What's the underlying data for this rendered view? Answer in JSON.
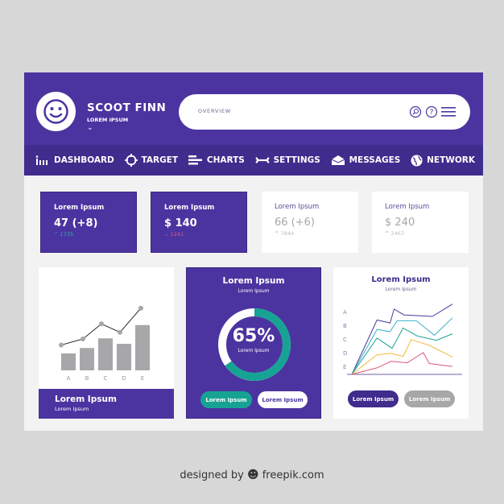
{
  "user": {
    "name": "SCOOT FINN",
    "subtitle": "LOREM IPSUM"
  },
  "search": {
    "label": "OVERVIEW",
    "icons": [
      "search-icon",
      "help-icon",
      "menu-icon"
    ]
  },
  "nav": [
    {
      "label": "DASHBOARD",
      "icon": "dashboard-icon"
    },
    {
      "label": "TARGET",
      "icon": "target-icon"
    },
    {
      "label": "CHARTS",
      "icon": "charts-icon"
    },
    {
      "label": "SETTINGS",
      "icon": "settings-icon"
    },
    {
      "label": "MESSAGES",
      "icon": "messages-icon"
    },
    {
      "label": "NETWORK",
      "icon": "network-icon"
    }
  ],
  "stats": [
    {
      "title": "Lorem Ipsum",
      "value": "47 (+8)",
      "sub": "1735",
      "trend": "up"
    },
    {
      "title": "Lorem Ipsum",
      "value": "$ 140",
      "sub": "1241",
      "trend": "down"
    },
    {
      "title": "Lorem Ipsum",
      "value": "66 (+6)",
      "sub": "7844",
      "trend": "up"
    },
    {
      "title": "Lorem Ipsum",
      "value": "$ 240",
      "sub": "2467",
      "trend": "up"
    }
  ],
  "card1": {
    "title": "Lorem Ipsum",
    "subtitle": "Lorem Ipsum"
  },
  "card2": {
    "title": "Lorem Ipsum",
    "subtitle": "Lorem Ipsum",
    "percent_label": "65%",
    "center_sub": "Lorem Ipsum",
    "btn1": "Lorem Ipsum",
    "btn2": "Lorem Ipsum"
  },
  "card3": {
    "title": "Lorem Ipsum",
    "subtitle": "Lorem Ipsum",
    "btn1": "Lorem Ipsum",
    "btn2": "Lorem Ipsum"
  },
  "colors": {
    "primary": "#4b34a0",
    "nav": "#3f2c8c",
    "teal": "#17a394",
    "up": "#2bb3a3",
    "down": "#e0577a"
  },
  "chart_data": [
    {
      "type": "bar",
      "categories": [
        "A",
        "B",
        "C",
        "D",
        "E"
      ],
      "values": [
        28,
        37,
        53,
        44,
        75
      ],
      "line_values": [
        42,
        52,
        77,
        63,
        103
      ]
    },
    {
      "type": "pie",
      "values": [
        65,
        35
      ],
      "label": "65%"
    },
    {
      "type": "line",
      "y_labels": [
        "A",
        "B",
        "C",
        "D",
        "E"
      ],
      "series": [
        {
          "color": "#4b3a9a",
          "x": [
            0,
            25,
            38,
            42,
            52,
            80,
            100
          ],
          "y": [
            0,
            75,
            71,
            90,
            82,
            80,
            97
          ]
        },
        {
          "color": "#3bb0cf",
          "x": [
            0,
            25,
            38,
            45,
            64,
            82,
            100
          ],
          "y": [
            0,
            62,
            59,
            74,
            74,
            54,
            78
          ]
        },
        {
          "color": "#1aa393",
          "x": [
            0,
            25,
            40,
            51,
            65,
            84,
            100
          ],
          "y": [
            0,
            50,
            36,
            64,
            53,
            47,
            56
          ]
        },
        {
          "color": "#f5b93c",
          "x": [
            0,
            25,
            38,
            51,
            59,
            77,
            100
          ],
          "y": [
            0,
            27,
            29,
            25,
            48,
            40,
            24
          ]
        },
        {
          "color": "#e0577a",
          "x": [
            0,
            25,
            39,
            55,
            71,
            77,
            100
          ],
          "y": [
            0,
            9,
            18,
            16,
            30,
            15,
            11
          ]
        }
      ]
    }
  ],
  "footer": {
    "prefix": "designed by",
    "brand": "freepik.com"
  }
}
